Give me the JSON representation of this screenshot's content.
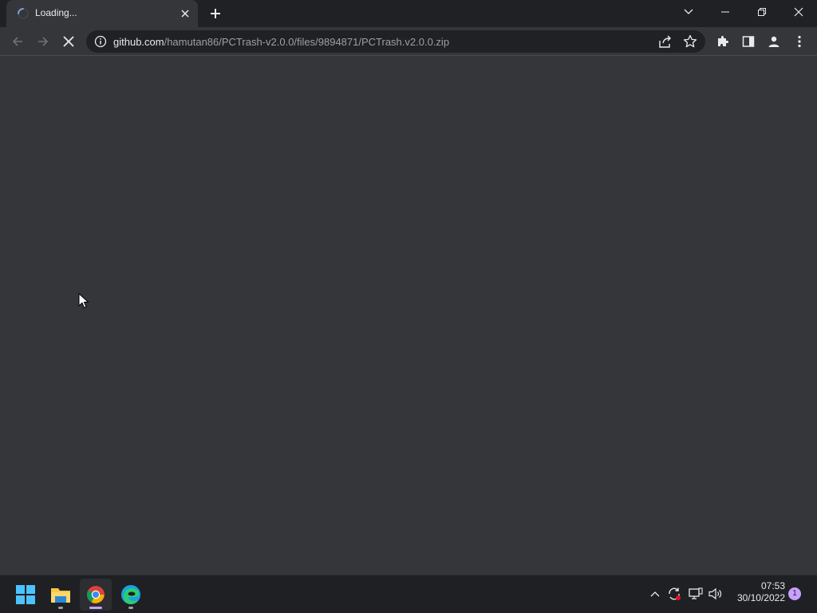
{
  "tab": {
    "title": "Loading...",
    "spinner_icon": "loading-spinner-icon",
    "close_icon": "close-icon"
  },
  "new_tab_icon": "plus-icon",
  "window_controls": [
    "chevron-down-icon",
    "minimize-icon",
    "restore-icon",
    "close-icon"
  ],
  "toolbar": {
    "back_icon": "arrow-left-icon",
    "forward_icon": "arrow-right-icon",
    "stop_icon": "close-icon",
    "url_host": "github.com",
    "url_path": "/hamutan86/PCTrash-v2.0.0/files/9894871/PCTrash.v2.0.0.zip",
    "extensions_icon": "puzzle-icon",
    "sidepanel_icon": "side-panel-icon",
    "profile_icon": "person-icon",
    "menu_icon": "kebab-menu-icon"
  },
  "taskbar": {
    "apps": [
      "windows-start-icon",
      "file-explorer-icon",
      "chrome-icon",
      "edge-icon"
    ],
    "time": "07:53",
    "date": "30/10/2022",
    "notification_count": "1"
  },
  "colors": {
    "titlebar": "#202124",
    "toolbar": "#35363a",
    "omnibox": "#202124",
    "taskbar": "#1f2023",
    "accent": "#c9a0ff"
  }
}
